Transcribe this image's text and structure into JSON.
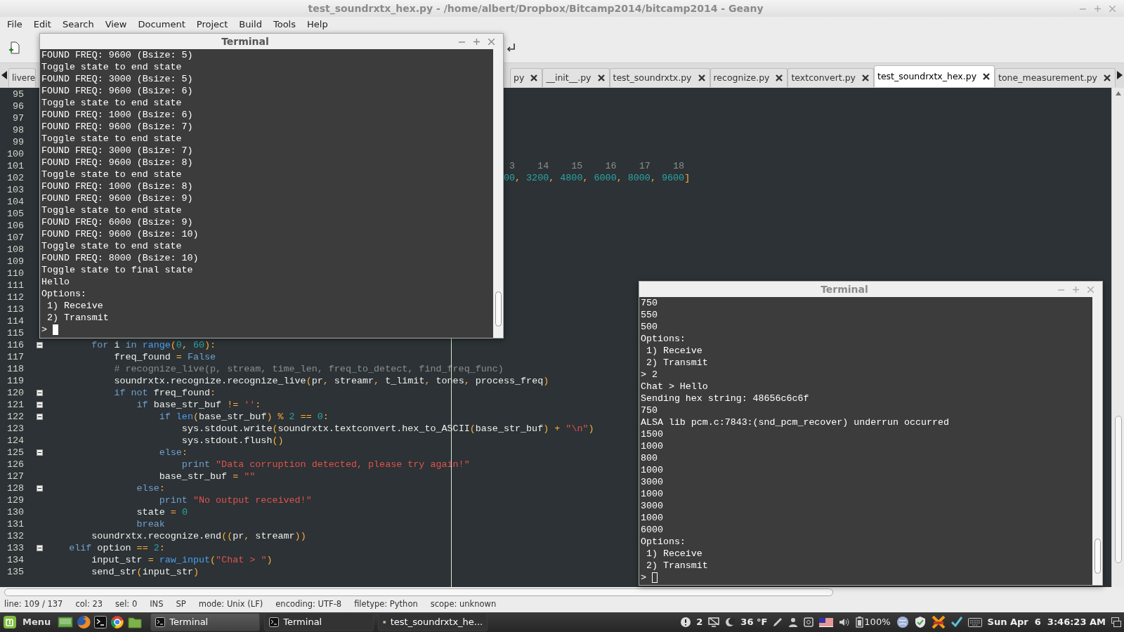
{
  "window": {
    "title": "test_soundrxtx_hex.py - /home/albert/Dropbox/Bitcamp2014/bitcamp2014 - Geany"
  },
  "menu": [
    "File",
    "Edit",
    "Search",
    "View",
    "Document",
    "Project",
    "Build",
    "Tools",
    "Help"
  ],
  "tabs": [
    {
      "label": "livere",
      "selected": false,
      "has_close": false
    },
    {
      "label": "py",
      "selected": false,
      "has_close": true
    },
    {
      "label": "__init__.py",
      "selected": false,
      "has_close": true
    },
    {
      "label": "test_soundrxtx.py",
      "selected": false,
      "has_close": true
    },
    {
      "label": "recognize.py",
      "selected": false,
      "has_close": true
    },
    {
      "label": "textconvert.py",
      "selected": false,
      "has_close": true
    },
    {
      "label": "test_soundrxtx_hex.py",
      "selected": true,
      "has_close": true
    },
    {
      "label": "tone_measurement.py",
      "selected": false,
      "has_close": true
    }
  ],
  "editor": {
    "lines": [
      {
        "number": "95",
        "fold": false
      },
      {
        "number": "96",
        "fold": false
      },
      {
        "number": "97",
        "fold": false
      },
      {
        "number": "98",
        "fold": false
      },
      {
        "number": "99",
        "fold": false
      },
      {
        "number": "100",
        "fold": false
      },
      {
        "number": "101",
        "fold": false,
        "segments": [
          {
            "kind": "comment",
            "text": "                                                                                  3    14    15    16    17    18"
          }
        ]
      },
      {
        "number": "102",
        "fold": false,
        "segments": [
          {
            "kind": "number",
            "text": "                                                                                 00"
          },
          {
            "kind": "op",
            "text": ", "
          },
          {
            "kind": "number",
            "text": "3200"
          },
          {
            "kind": "op",
            "text": ", "
          },
          {
            "kind": "number",
            "text": "4800"
          },
          {
            "kind": "op",
            "text": ", "
          },
          {
            "kind": "number",
            "text": "6000"
          },
          {
            "kind": "op",
            "text": ", "
          },
          {
            "kind": "number",
            "text": "8000"
          },
          {
            "kind": "op",
            "text": ", "
          },
          {
            "kind": "number",
            "text": "9600"
          },
          {
            "kind": "op",
            "text": "]"
          }
        ]
      },
      {
        "number": "103",
        "fold": false
      },
      {
        "number": "104",
        "fold": false
      },
      {
        "number": "105",
        "fold": false
      },
      {
        "number": "106",
        "fold": false
      },
      {
        "number": "107",
        "fold": false
      },
      {
        "number": "108",
        "fold": false
      },
      {
        "number": "109",
        "fold": false
      },
      {
        "number": "110",
        "fold": false
      },
      {
        "number": "111",
        "fold": false
      },
      {
        "number": "112",
        "fold": false
      },
      {
        "number": "113",
        "fold": false
      },
      {
        "number": "114",
        "fold": false
      },
      {
        "number": "115",
        "fold": false
      },
      {
        "number": "116",
        "fold": true,
        "segments": [
          {
            "kind": "keyword",
            "text": "        for"
          },
          {
            "kind": "plain",
            "text": " i "
          },
          {
            "kind": "keyword",
            "text": "in "
          },
          {
            "kind": "builtin",
            "text": "range"
          },
          {
            "kind": "op",
            "text": "("
          },
          {
            "kind": "number",
            "text": "0"
          },
          {
            "kind": "op",
            "text": ", "
          },
          {
            "kind": "number",
            "text": "60"
          },
          {
            "kind": "op",
            "text": "):"
          }
        ]
      },
      {
        "number": "117",
        "fold": false,
        "segments": [
          {
            "kind": "plain",
            "text": "            freq_found "
          },
          {
            "kind": "op",
            "text": "= "
          },
          {
            "kind": "keyword",
            "text": "False"
          }
        ]
      },
      {
        "number": "118",
        "fold": false,
        "segments": [
          {
            "kind": "comment",
            "text": "            # recognize_live(p, stream, time_len, freq_to_detect, find_freq_func)"
          }
        ]
      },
      {
        "number": "119",
        "fold": false,
        "segments": [
          {
            "kind": "plain",
            "text": "            soundrxtx.recognize.recognize_live"
          },
          {
            "kind": "op",
            "text": "("
          },
          {
            "kind": "plain",
            "text": "pr"
          },
          {
            "kind": "op",
            "text": ", "
          },
          {
            "kind": "plain",
            "text": "streamr"
          },
          {
            "kind": "op",
            "text": ", "
          },
          {
            "kind": "plain",
            "text": "t_limit"
          },
          {
            "kind": "op",
            "text": ", "
          },
          {
            "kind": "plain",
            "text": "tones"
          },
          {
            "kind": "op",
            "text": ", "
          },
          {
            "kind": "plain",
            "text": "process_freq"
          },
          {
            "kind": "op",
            "text": ")"
          }
        ]
      },
      {
        "number": "120",
        "fold": true,
        "segments": [
          {
            "kind": "keyword",
            "text": "            if not"
          },
          {
            "kind": "plain",
            "text": " freq_found"
          },
          {
            "kind": "op",
            "text": ":"
          }
        ]
      },
      {
        "number": "121",
        "fold": true,
        "segments": [
          {
            "kind": "keyword",
            "text": "                if"
          },
          {
            "kind": "plain",
            "text": " base_str_buf "
          },
          {
            "kind": "op",
            "text": "!= "
          },
          {
            "kind": "string",
            "text": "''"
          },
          {
            "kind": "op",
            "text": ":"
          }
        ]
      },
      {
        "number": "122",
        "fold": true,
        "segments": [
          {
            "kind": "keyword",
            "text": "                    if "
          },
          {
            "kind": "builtin",
            "text": "len"
          },
          {
            "kind": "op",
            "text": "("
          },
          {
            "kind": "plain",
            "text": "base_str_buf"
          },
          {
            "kind": "op",
            "text": ") % "
          },
          {
            "kind": "number",
            "text": "2"
          },
          {
            "kind": "op",
            "text": " == "
          },
          {
            "kind": "number",
            "text": "0"
          },
          {
            "kind": "op",
            "text": ":"
          }
        ]
      },
      {
        "number": "123",
        "fold": false,
        "segments": [
          {
            "kind": "plain",
            "text": "                        sys.stdout.write"
          },
          {
            "kind": "op",
            "text": "("
          },
          {
            "kind": "plain",
            "text": "soundrxtx.textconvert.hex_to_ASCII"
          },
          {
            "kind": "op",
            "text": "("
          },
          {
            "kind": "plain",
            "text": "base_str_buf"
          },
          {
            "kind": "op",
            "text": ") + "
          },
          {
            "kind": "string",
            "text": "\"\\n\""
          },
          {
            "kind": "op",
            "text": ")"
          }
        ]
      },
      {
        "number": "124",
        "fold": false,
        "segments": [
          {
            "kind": "plain",
            "text": "                        sys.stdout.flush"
          },
          {
            "kind": "op",
            "text": "()"
          }
        ]
      },
      {
        "number": "125",
        "fold": true,
        "segments": [
          {
            "kind": "keyword",
            "text": "                    else"
          },
          {
            "kind": "op",
            "text": ":"
          }
        ]
      },
      {
        "number": "126",
        "fold": false,
        "segments": [
          {
            "kind": "keyword",
            "text": "                        print "
          },
          {
            "kind": "string",
            "text": "\"Data corruption detected, please try again!\""
          }
        ]
      },
      {
        "number": "127",
        "fold": false,
        "segments": [
          {
            "kind": "plain",
            "text": "                    base_str_buf "
          },
          {
            "kind": "op",
            "text": "= "
          },
          {
            "kind": "string",
            "text": "\"\""
          }
        ]
      },
      {
        "number": "128",
        "fold": true,
        "segments": [
          {
            "kind": "keyword",
            "text": "                else"
          },
          {
            "kind": "op",
            "text": ":"
          }
        ]
      },
      {
        "number": "129",
        "fold": false,
        "segments": [
          {
            "kind": "keyword",
            "text": "                    print "
          },
          {
            "kind": "string",
            "text": "\"No output received!\""
          }
        ]
      },
      {
        "number": "130",
        "fold": false,
        "segments": [
          {
            "kind": "plain",
            "text": "                state "
          },
          {
            "kind": "op",
            "text": "= "
          },
          {
            "kind": "number",
            "text": "0"
          }
        ]
      },
      {
        "number": "131",
        "fold": false,
        "segments": [
          {
            "kind": "keyword",
            "text": "                break"
          }
        ]
      },
      {
        "number": "132",
        "fold": false,
        "segments": [
          {
            "kind": "plain",
            "text": "        soundrxtx.recognize.end"
          },
          {
            "kind": "op",
            "text": "(("
          },
          {
            "kind": "plain",
            "text": "pr"
          },
          {
            "kind": "op",
            "text": ", "
          },
          {
            "kind": "plain",
            "text": "streamr"
          },
          {
            "kind": "op",
            "text": "))"
          }
        ]
      },
      {
        "number": "133",
        "fold": true,
        "segments": [
          {
            "kind": "keyword",
            "text": "    elif"
          },
          {
            "kind": "plain",
            "text": " option "
          },
          {
            "kind": "op",
            "text": "== "
          },
          {
            "kind": "number",
            "text": "2"
          },
          {
            "kind": "op",
            "text": ":"
          }
        ]
      },
      {
        "number": "134",
        "fold": false,
        "segments": [
          {
            "kind": "plain",
            "text": "        input_str "
          },
          {
            "kind": "op",
            "text": "= "
          },
          {
            "kind": "builtin",
            "text": "raw_input"
          },
          {
            "kind": "op",
            "text": "("
          },
          {
            "kind": "string",
            "text": "\"Chat > \""
          },
          {
            "kind": "op",
            "text": ")"
          }
        ]
      },
      {
        "number": "135",
        "fold": false,
        "segments": [
          {
            "kind": "plain",
            "text": "        send_str"
          },
          {
            "kind": "op",
            "text": "("
          },
          {
            "kind": "plain",
            "text": "input_str"
          },
          {
            "kind": "op",
            "text": ")"
          }
        ]
      }
    ]
  },
  "status_bar": [
    "line: 109 / 137",
    "col: 23",
    "sel: 0",
    "INS",
    "SP",
    "mode: Unix (LF)",
    "encoding: UTF-8",
    "filetype: Python",
    "scope: unknown"
  ],
  "terminals": [
    {
      "title": "Terminal",
      "focused": true,
      "lines": [
        "FOUND FREQ: 9600 (Bsize: 5)",
        "Toggle state to end state",
        "FOUND FREQ: 3000 (Bsize: 5)",
        "FOUND FREQ: 9600 (Bsize: 6)",
        "Toggle state to end state",
        "FOUND FREQ: 1000 (Bsize: 6)",
        "FOUND FREQ: 9600 (Bsize: 7)",
        "Toggle state to end state",
        "FOUND FREQ: 3000 (Bsize: 7)",
        "FOUND FREQ: 9600 (Bsize: 8)",
        "Toggle state to end state",
        "FOUND FREQ: 1000 (Bsize: 8)",
        "FOUND FREQ: 9600 (Bsize: 9)",
        "Toggle state to end state",
        "FOUND FREQ: 6000 (Bsize: 9)",
        "FOUND FREQ: 9600 (Bsize: 10)",
        "Toggle state to end state",
        "FOUND FREQ: 8000 (Bsize: 10)",
        "Toggle state to final state",
        "Hello",
        "Options:",
        " 1) Receive",
        " 2) Transmit",
        ">"
      ]
    },
    {
      "title": "Terminal",
      "focused": false,
      "lines": [
        "750",
        "550",
        "500",
        "Options:",
        " 1) Receive",
        " 2) Transmit",
        "> 2",
        "Chat > Hello",
        "Sending hex string: 48656c6c6f",
        "750",
        "ALSA lib pcm.c:7843:(snd_pcm_recover) underrun occurred",
        "1500",
        "1000",
        "800",
        "1000",
        "3000",
        "1000",
        "3000",
        "1000",
        "6000",
        "Options:",
        " 1) Receive",
        " 2) Transmit",
        ">"
      ]
    }
  ],
  "taskbar": {
    "menu": "Menu",
    "tasks": [
      {
        "label": "Terminal",
        "kind": "terminal",
        "selected": true
      },
      {
        "label": "Terminal",
        "kind": "terminal",
        "selected": false
      },
      {
        "label": "test_soundrxtx_he...",
        "kind": "editor",
        "selected": false
      }
    ],
    "tray": {
      "alerts": "2",
      "temperature": "36 °F",
      "battery": "100%",
      "clock": "Sun Apr  6  3:46:23 AM"
    }
  }
}
